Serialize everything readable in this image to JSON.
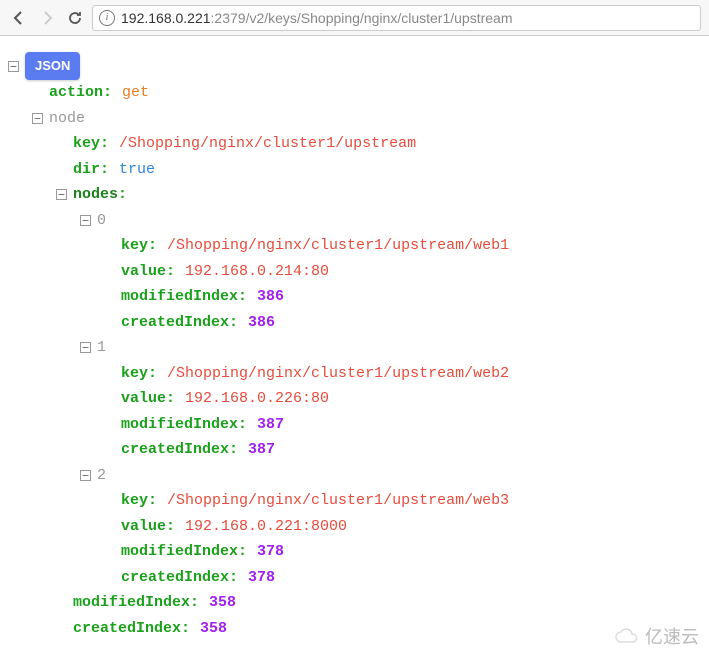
{
  "browser": {
    "host": "192.168.0.221",
    "path": ":2379/v2/keys/Shopping/nginx/cluster1/upstream"
  },
  "badge": "JSON",
  "labels": {
    "action": "action",
    "node": "node",
    "key": "key",
    "dir": "dir",
    "nodes": "nodes",
    "value": "value",
    "modifiedIndex": "modifiedIndex",
    "createdIndex": "createdIndex"
  },
  "root": {
    "action": "get",
    "node": {
      "key": "/Shopping/nginx/cluster1/upstream",
      "dir": "true",
      "modifiedIndex": "358",
      "createdIndex": "358",
      "nodes": [
        {
          "idx": "0",
          "key": "/Shopping/nginx/cluster1/upstream/web1",
          "value": "192.168.0.214:80",
          "modifiedIndex": "386",
          "createdIndex": "386"
        },
        {
          "idx": "1",
          "key": "/Shopping/nginx/cluster1/upstream/web2",
          "value": "192.168.0.226:80",
          "modifiedIndex": "387",
          "createdIndex": "387"
        },
        {
          "idx": "2",
          "key": "/Shopping/nginx/cluster1/upstream/web3",
          "value": "192.168.0.221:8000",
          "modifiedIndex": "378",
          "createdIndex": "378"
        }
      ]
    }
  },
  "watermark": "亿速云"
}
